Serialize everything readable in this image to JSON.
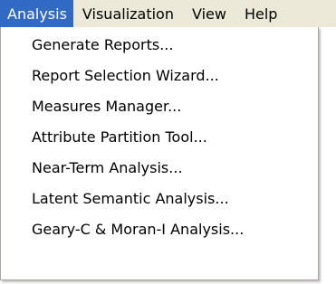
{
  "menubar": {
    "items": [
      {
        "label": "Analysis"
      },
      {
        "label": "Visualization"
      },
      {
        "label": "View"
      },
      {
        "label": "Help"
      }
    ]
  },
  "dropdown": {
    "items": [
      {
        "label": "Generate Reports..."
      },
      {
        "label": "Report Selection Wizard..."
      },
      {
        "label": "Measures Manager..."
      },
      {
        "label": "Attribute Partition Tool..."
      },
      {
        "label": "Near-Term Analysis..."
      },
      {
        "label": "Latent Semantic Analysis..."
      },
      {
        "label": "Geary-C & Moran-I Analysis..."
      }
    ]
  },
  "colors": {
    "menubar_background": "#ece9d8",
    "highlight": "#316ac5",
    "menu_background": "#ffffff",
    "menu_border": "#aca899"
  }
}
